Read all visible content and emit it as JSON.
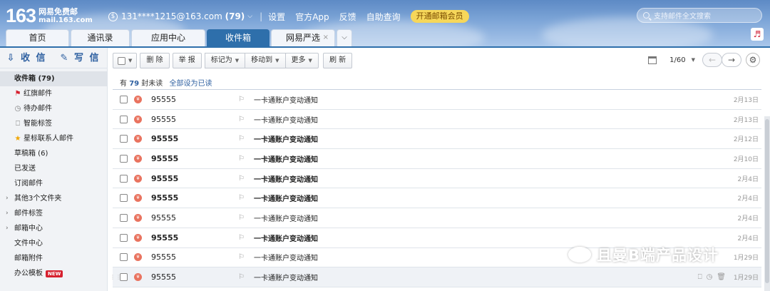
{
  "logo": {
    "num": "163",
    "line1": "网易免费邮",
    "line2": "mail.163.com"
  },
  "topbar": {
    "account": "131****1215@163.com",
    "count": "(79)",
    "links": [
      "设置",
      "官方App",
      "反馈",
      "自助查询"
    ],
    "vip": "开通邮箱会员"
  },
  "search": {
    "placeholder": "支持邮件全文搜索"
  },
  "tabs": [
    {
      "label": "首页",
      "w": 1
    },
    {
      "label": "通讯录"
    },
    {
      "label": "应用中心"
    },
    {
      "label": "收件箱"
    },
    {
      "label": "网易严选",
      "close": "×"
    }
  ],
  "sidebar": {
    "receive": "收 信",
    "write": "写 信",
    "items": [
      {
        "label": "收件箱 (79)"
      },
      {
        "label": "红旗邮件"
      },
      {
        "label": "待办邮件"
      },
      {
        "label": "智能标签"
      },
      {
        "label": "星标联系人邮件"
      },
      {
        "label": "草稿箱 (6)"
      },
      {
        "label": "已发送"
      },
      {
        "label": "订阅邮件"
      },
      {
        "label": "其他3个文件夹"
      },
      {
        "label": "邮件标签"
      },
      {
        "label": "邮箱中心"
      },
      {
        "label": "文件中心"
      },
      {
        "label": "邮箱附件"
      },
      {
        "label": "办公模板"
      }
    ],
    "new_badge": "NEW"
  },
  "toolbar": {
    "delete": "删 除",
    "report": "举 报",
    "mark": "标记为",
    "move": "移动到",
    "more": "更多",
    "refresh": "刷 新",
    "page": "1/60"
  },
  "summary": {
    "pre": "有",
    "count": "79",
    "post": "封未读",
    "mark_all": "全部设为已读"
  },
  "emails": [
    {
      "from": "95555",
      "subject": "一卡通账户变动通知",
      "date": "2月13日",
      "unread": false
    },
    {
      "from": "95555",
      "subject": "一卡通账户变动通知",
      "date": "2月13日",
      "unread": false
    },
    {
      "from": "95555",
      "subject": "一卡通账户变动通知",
      "date": "2月12日",
      "unread": true
    },
    {
      "from": "95555",
      "subject": "一卡通账户变动通知",
      "date": "2月10日",
      "unread": true
    },
    {
      "from": "95555",
      "subject": "一卡通账户变动通知",
      "date": "2月4日",
      "unread": true
    },
    {
      "from": "95555",
      "subject": "一卡通账户变动通知",
      "date": "2月4日",
      "unread": true
    },
    {
      "from": "95555",
      "subject": "一卡通账户变动通知",
      "date": "2月4日",
      "unread": false
    },
    {
      "from": "95555",
      "subject": "一卡通账户变动通知",
      "date": "2月4日",
      "unread": true
    },
    {
      "from": "95555",
      "subject": "一卡通账户变动通知",
      "date": "1月29日",
      "unread": false
    },
    {
      "from": "95555",
      "subject": "一卡通账户变动通知",
      "date": "1月29日",
      "unread": false
    }
  ],
  "watermark": "且曼B端产品设计",
  "colors": {
    "accent": "#2e6fab",
    "vip": "#f6d75a",
    "new": "#d6212f"
  }
}
